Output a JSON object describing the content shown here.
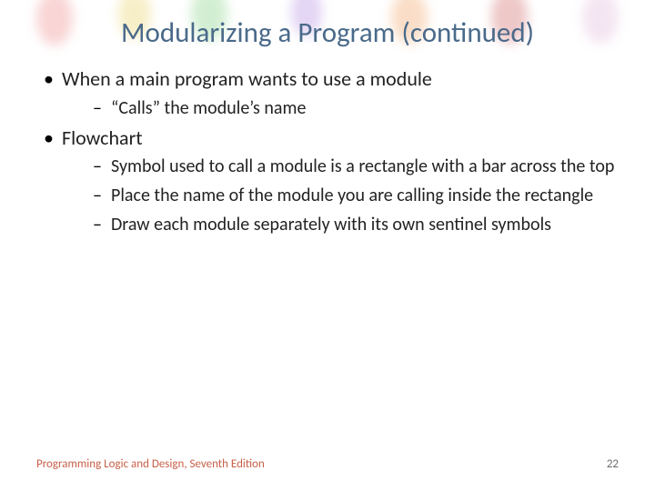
{
  "title": "Modularizing a Program (continued)",
  "bullets": [
    {
      "text": "When a main program wants to use a module",
      "sub": [
        "“Calls” the module’s name"
      ]
    },
    {
      "text": "Flowchart",
      "sub": [
        "Symbol used to call a module is a rectangle with a bar across the top",
        "Place the name of the module you are calling inside the rectangle",
        "Draw each module separately with its own sentinel symbols"
      ]
    }
  ],
  "footer": "Programming Logic and Design, Seventh Edition",
  "page_number": "22"
}
